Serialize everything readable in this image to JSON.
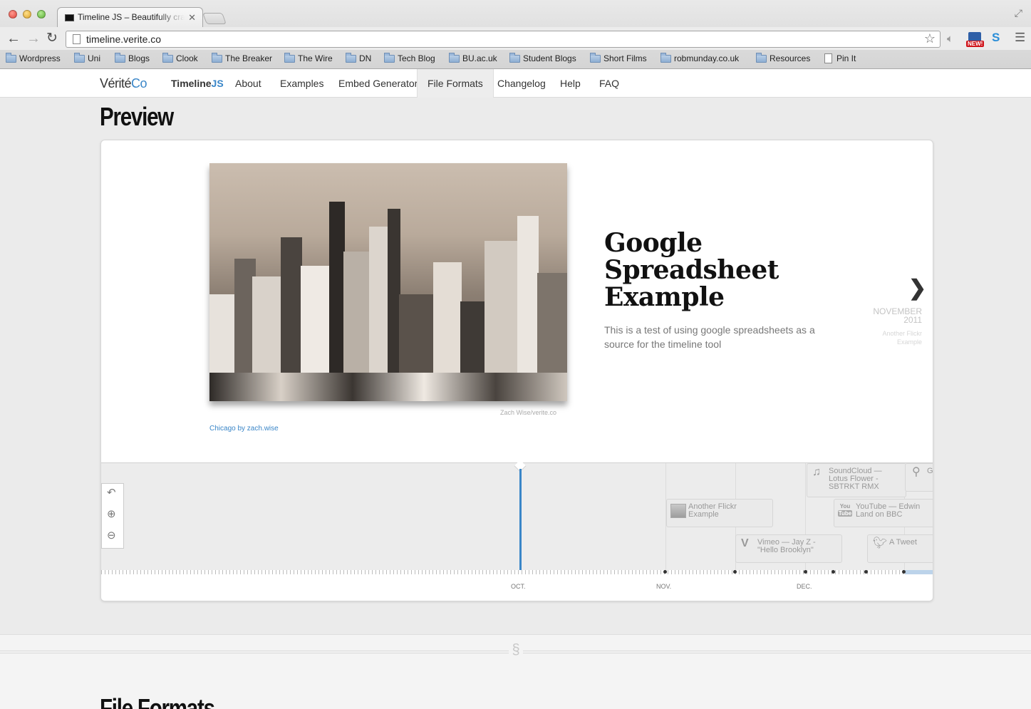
{
  "browser": {
    "tab_title": "Timeline JS – Beautifully crafted timelines",
    "url": "timeline.verite.co",
    "bookmarks": [
      {
        "label": "Wordpress",
        "type": "folder"
      },
      {
        "label": "Uni",
        "type": "folder"
      },
      {
        "label": "Blogs",
        "type": "folder"
      },
      {
        "label": "Clook",
        "type": "folder"
      },
      {
        "label": "The Breaker",
        "type": "folder"
      },
      {
        "label": "The Wire",
        "type": "folder"
      },
      {
        "label": "DN",
        "type": "folder"
      },
      {
        "label": "Tech Blog",
        "type": "folder"
      },
      {
        "label": "BU.ac.uk",
        "type": "folder"
      },
      {
        "label": "Student Blogs",
        "type": "folder"
      },
      {
        "label": "Short Films",
        "type": "folder"
      },
      {
        "label": "robmunday.co.uk",
        "type": "folder"
      },
      {
        "label": "Resources",
        "type": "folder"
      },
      {
        "label": "Pin It",
        "type": "page"
      }
    ],
    "extension_badge": "NEW!"
  },
  "site_nav": {
    "logo_main": "Vérité",
    "logo_accent": "Co",
    "brand_main": "Timeline",
    "brand_accent": "JS",
    "items": [
      "About",
      "Examples",
      "Embed Generator",
      "File Formats",
      "Changelog",
      "Help",
      "FAQ"
    ],
    "active": "File Formats"
  },
  "preview": {
    "heading": "Preview",
    "slide": {
      "headline": "Google Spreadsheet Example",
      "body": "This is a test of using google spreadsheets as a source for the timeline tool",
      "media_credit": "Zach Wise/verite.co",
      "media_caption": "Chicago by zach.wise"
    },
    "next": {
      "date_month": "NOVEMBER",
      "date_year": "2011",
      "title_line1": "Another Flickr",
      "title_line2": "Example"
    },
    "timeline": {
      "events": [
        {
          "title_line1": "SoundCloud —",
          "title_line2": "Lotus Flower -",
          "title_line3": "SBTRKT RMX",
          "icon": "music-note-icon"
        },
        {
          "title_line1": "G",
          "icon": "map-pin-icon"
        },
        {
          "title_line1": "Another Flickr",
          "title_line2": "Example",
          "icon": "image-thumbnail-icon"
        },
        {
          "title_line1": "YouTube — Edwin",
          "title_line2": "Land on BBC",
          "icon": "youtube-icon"
        },
        {
          "title_line1": "Vimeo — Jay Z -",
          "title_line2": "\"Hello Brooklyn\"",
          "icon": "vimeo-icon"
        },
        {
          "title_line1": "A Tweet",
          "icon": "twitter-bird-icon"
        }
      ],
      "months": [
        "OCT.",
        "NOV.",
        "DEC."
      ]
    }
  },
  "divider_symbol": "§",
  "next_section_heading": "File Formats"
}
